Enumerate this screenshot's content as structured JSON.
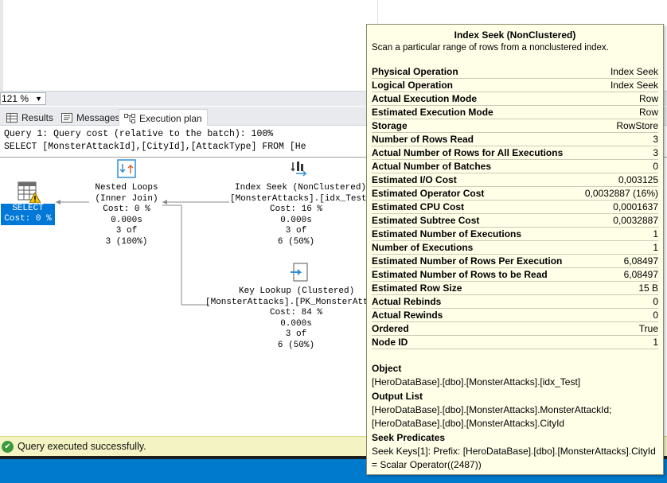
{
  "zoom": {
    "value": "121 %"
  },
  "tabs": [
    {
      "label": "Results"
    },
    {
      "label": "Messages"
    },
    {
      "label": "Execution plan"
    }
  ],
  "plan": {
    "query_line1": "Query 1: Query cost (relative to the batch): 100%",
    "query_line2": "SELECT [MonsterAttackId],[CityId],[AttackType] FROM [He",
    "select_node": {
      "label": "SELECT",
      "cost": "Cost: 0 %"
    },
    "nested_loops": [
      "Nested Loops",
      "(Inner Join)",
      "Cost: 0 %",
      "0.000s",
      "3 of",
      "3 (100%)"
    ],
    "index_seek": [
      "Index Seek (NonClustered)",
      "[MonsterAttacks].[idx_Test",
      "Cost: 16 %",
      "0.000s",
      "3 of",
      "6 (50%)"
    ],
    "key_lookup": [
      "Key Lookup (Clustered)",
      "[MonsterAttacks].[PK_MonsterAtt",
      "Cost: 84 %",
      "0.000s",
      "3 of",
      "6 (50%)"
    ]
  },
  "tooltip": {
    "title": "Index Seek (NonClustered)",
    "description": "Scan a particular range of rows from a nonclustered index.",
    "properties": [
      {
        "name": "Physical Operation",
        "value": "Index Seek"
      },
      {
        "name": "Logical Operation",
        "value": "Index Seek"
      },
      {
        "name": "Actual Execution Mode",
        "value": "Row"
      },
      {
        "name": "Estimated Execution Mode",
        "value": "Row"
      },
      {
        "name": "Storage",
        "value": "RowStore"
      },
      {
        "name": "Number of Rows Read",
        "value": "3"
      },
      {
        "name": "Actual Number of Rows for All Executions",
        "value": "3"
      },
      {
        "name": "Actual Number of Batches",
        "value": "0"
      },
      {
        "name": "Estimated I/O Cost",
        "value": "0,003125"
      },
      {
        "name": "Estimated Operator Cost",
        "value": "0,0032887 (16%)"
      },
      {
        "name": "Estimated CPU Cost",
        "value": "0,0001637"
      },
      {
        "name": "Estimated Subtree Cost",
        "value": "0,0032887"
      },
      {
        "name": "Estimated Number of Executions",
        "value": "1"
      },
      {
        "name": "Number of Executions",
        "value": "1"
      },
      {
        "name": "Estimated Number of Rows Per Execution",
        "value": "6,08497"
      },
      {
        "name": "Estimated Number of Rows to be Read",
        "value": "6,08497"
      },
      {
        "name": "Estimated Row Size",
        "value": "15 B"
      },
      {
        "name": "Actual Rebinds",
        "value": "0"
      },
      {
        "name": "Actual Rewinds",
        "value": "0"
      },
      {
        "name": "Ordered",
        "value": "True"
      },
      {
        "name": "Node ID",
        "value": "1"
      }
    ],
    "object_label": "Object",
    "object_value": "[HeroDataBase].[dbo].[MonsterAttacks].[idx_Test]",
    "output_label": "Output List",
    "output_line1": "[HeroDataBase].[dbo].[MonsterAttacks].MonsterAttackId;",
    "output_line2": "[HeroDataBase].[dbo].[MonsterAttacks].CityId",
    "seek_label": "Seek Predicates",
    "seek_line1": "Seek Keys[1]: Prefix: [HeroDataBase].[dbo].[MonsterAttacks].CityId",
    "seek_line2": "= Scalar Operator((2487))"
  },
  "status": {
    "text": "Query executed successfully."
  },
  "icons": {
    "select": "select-table-icon",
    "warning": "warning-icon",
    "nested_loops": "nested-loops-icon",
    "index_seek": "index-seek-icon",
    "key_lookup": "key-lookup-icon",
    "status": "check-icon"
  },
  "colors": {
    "select_highlight": "#0078d7",
    "tooltip_bg": "#ffffe8",
    "status_bg": "#f4f3c4",
    "bottom_band": "#007acc"
  }
}
